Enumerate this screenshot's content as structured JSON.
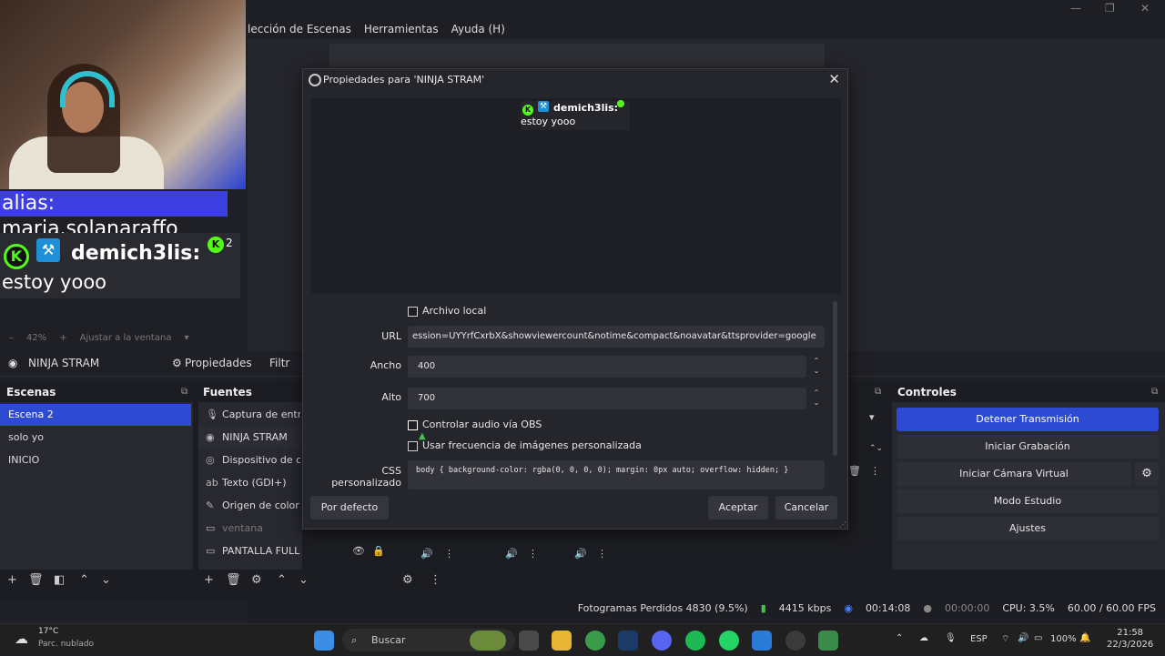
{
  "menu": [
    "lección de Escenas",
    "Herramientas",
    "Ayuda (H)"
  ],
  "overlay": {
    "alias": "alias: maria.solanaraffo",
    "chat_user": "demich3lis:",
    "chat_badge_count": "2",
    "chat_message": "estoy yooo"
  },
  "zoom": {
    "percent": "42%",
    "fit": "Ajustar a la ventana"
  },
  "source_bar": {
    "source_name": "NINJA STRAM",
    "properties": "Propiedades",
    "filters": "Filtr"
  },
  "docks": {
    "scenes_title": "Escenas",
    "sources_title": "Fuentes",
    "controls_title": "Controles",
    "scenes": [
      "Escena 2",
      "solo yo",
      "INICIO"
    ],
    "sources": [
      {
        "icon": "microphone-icon",
        "label": "Captura de entrad"
      },
      {
        "icon": "globe-icon",
        "label": "NINJA STRAM"
      },
      {
        "icon": "camera-icon",
        "label": "Dispositivo de ca"
      },
      {
        "icon": "text-icon",
        "label": "Texto (GDI+)"
      },
      {
        "icon": "palette-icon",
        "label": "Origen de color"
      },
      {
        "icon": "window-icon",
        "label": "ventana"
      },
      {
        "icon": "monitor-icon",
        "label": "PANTALLA FULL"
      }
    ],
    "controls": {
      "stop_stream": "Detener Transmisión",
      "start_record": "Iniciar Grabación",
      "start_vcam": "Iniciar Cámara Virtual",
      "studio_mode": "Modo Estudio",
      "settings": "Ajustes"
    }
  },
  "status": {
    "dropped": "Fotogramas Perdidos 4830 (9.5%)",
    "bitrate": "4415 kbps",
    "stream_time": "00:14:08",
    "rec_time": "00:00:00",
    "cpu": "CPU: 3.5%",
    "fps": "60.00 / 60.00 FPS"
  },
  "dialog": {
    "title": "Propiedades para 'NINJA STRAM'",
    "preview_user": "demich3lis:",
    "preview_message": "estoy yooo",
    "local_file": "Archivo local",
    "url_label": "URL",
    "url_value": "ession=UYYrfCxrbX&showviewercount&notime&compact&noavatar&ttsprovider=google",
    "width_label": "Ancho",
    "width_value": "400",
    "height_label": "Alto",
    "height_value": "700",
    "audio_control": "Controlar audio vía OBS",
    "custom_fps": "Usar frecuencia de imágenes personalizada",
    "css_label": "CSS personalizado",
    "css_value": "body { background-color: rgba(0, 0, 0, 0); margin: 0px auto; overflow: hidden; }",
    "defaults": "Por defecto",
    "accept": "Aceptar",
    "cancel": "Cancelar"
  },
  "taskbar": {
    "temp": "17°C",
    "weather": "Parc. nublado",
    "search": "Buscar",
    "lang": "ESP",
    "battery": "100%",
    "time": "21:58",
    "date": "22/3/2026"
  },
  "colors": {
    "accent": "#2c4bd2",
    "kick_green": "#53fc18",
    "alias_bg": "#3d3fe0"
  }
}
